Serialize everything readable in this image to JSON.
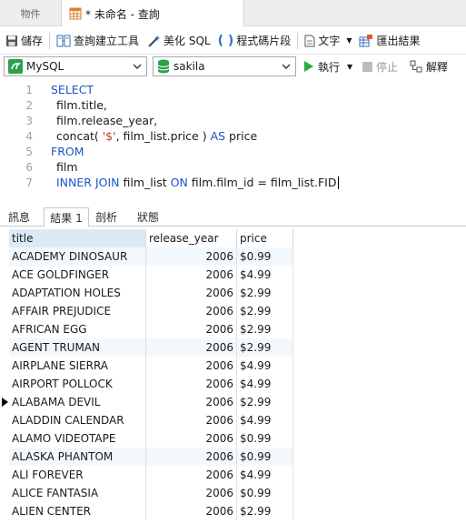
{
  "tabs": {
    "objects_label": "物件",
    "query_label": "* 未命名 - 查詢"
  },
  "toolbar": {
    "save_label": "儲存",
    "query_builder_label": "查詢建立工具",
    "beautify_label": "美化 SQL",
    "snippet_label": "程式碼片段",
    "text_label": "文字",
    "export_label": "匯出結果"
  },
  "connection": {
    "value": "MySQL",
    "database": "sakila",
    "run_label": "執行",
    "stop_label": "停止",
    "explain_label": "解釋"
  },
  "editor": {
    "line_numbers": [
      "1",
      "2",
      "3",
      "4",
      "5",
      "6",
      "7"
    ],
    "lines": {
      "l1_kw": "SELECT",
      "l2": "film.title,",
      "l3": "film.release_year,",
      "l4_a": "concat( ",
      "l4_str": "'$'",
      "l4_b": ", film_list.price ) ",
      "l4_kw": "AS",
      "l4_c": " price",
      "l5_kw": "FROM",
      "l6": "film",
      "l7_kw1": "INNER JOIN",
      "l7_a": " film_list ",
      "l7_kw2": "ON",
      "l7_b": " film.film_id = film_list.FID"
    }
  },
  "result_tabs": [
    "訊息",
    "結果 1",
    "剖析",
    "狀態"
  ],
  "grid": {
    "columns": [
      "title",
      "release_year",
      "price"
    ],
    "rows": [
      [
        "ACADEMY DINOSAUR",
        "2006",
        "$0.99"
      ],
      [
        "ACE GOLDFINGER",
        "2006",
        "$4.99"
      ],
      [
        "ADAPTATION HOLES",
        "2006",
        "$2.99"
      ],
      [
        "AFFAIR PREJUDICE",
        "2006",
        "$2.99"
      ],
      [
        "AFRICAN EGG",
        "2006",
        "$2.99"
      ],
      [
        "AGENT TRUMAN",
        "2006",
        "$2.99"
      ],
      [
        "AIRPLANE SIERRA",
        "2006",
        "$4.99"
      ],
      [
        "AIRPORT POLLOCK",
        "2006",
        "$4.99"
      ],
      [
        "ALABAMA DEVIL",
        "2006",
        "$2.99"
      ],
      [
        "ALADDIN CALENDAR",
        "2006",
        "$4.99"
      ],
      [
        "ALAMO VIDEOTAPE",
        "2006",
        "$0.99"
      ],
      [
        "ALASKA PHANTOM",
        "2006",
        "$0.99"
      ],
      [
        "ALI FOREVER",
        "2006",
        "$4.99"
      ],
      [
        "ALICE FANTASIA",
        "2006",
        "$0.99"
      ],
      [
        "ALIEN CENTER",
        "2006",
        "$2.99"
      ]
    ]
  },
  "colors": {
    "keyword": "#1a56c9",
    "string": "#c0392b",
    "run_green": "#2eaa3a",
    "header_selected": "#dde9f5"
  }
}
